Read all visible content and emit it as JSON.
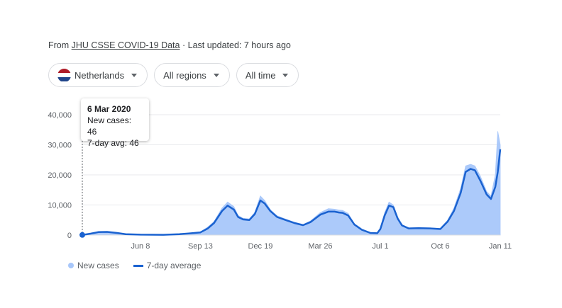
{
  "source": {
    "prefix": "From",
    "link": "JHU CSSE COVID-19 Data",
    "separator": "·",
    "updated": "Last updated: 7 hours ago"
  },
  "filters": {
    "country": "Netherlands",
    "region": "All regions",
    "time": "All time"
  },
  "flag_colors": [
    "#ae1c28",
    "#ffffff",
    "#21468b"
  ],
  "colors": {
    "bars": "#a8c7fa",
    "line": "#1a62d0",
    "grid": "#e8eaed",
    "axis_text": "#5f6368"
  },
  "tooltip": {
    "date": "6 Mar 2020",
    "new_cases": "New cases: 46",
    "avg": "7-day avg: 46"
  },
  "legend": {
    "new_cases": "New cases",
    "avg": "7-day average"
  },
  "chart_data": {
    "type": "area",
    "ylim": [
      0,
      40000
    ],
    "y_ticks": [
      {
        "value": 0,
        "label": "0"
      },
      {
        "value": 10000,
        "label": "10,000"
      },
      {
        "value": 20000,
        "label": "20,000"
      },
      {
        "value": 30000,
        "label": "30,000"
      },
      {
        "value": 40000,
        "label": "40,000"
      }
    ],
    "x_range": [
      "2020-03-06",
      "2022-01-11"
    ],
    "x_ticks": [
      {
        "date": "2020-06-08",
        "label": "Jun 8"
      },
      {
        "date": "2020-09-13",
        "label": "Sep 13"
      },
      {
        "date": "2020-12-19",
        "label": "Dec 19"
      },
      {
        "date": "2021-03-26",
        "label": "Mar 26"
      },
      {
        "date": "2021-07-01",
        "label": "Jul 1"
      },
      {
        "date": "2021-10-06",
        "label": "Oct 6"
      },
      {
        "date": "2022-01-11",
        "label": "Jan 11"
      }
    ],
    "series": [
      {
        "name": "7-day average",
        "points": [
          [
            "2020-03-06",
            46
          ],
          [
            "2020-03-20",
            500
          ],
          [
            "2020-04-01",
            1000
          ],
          [
            "2020-04-15",
            1050
          ],
          [
            "2020-05-01",
            700
          ],
          [
            "2020-05-15",
            300
          ],
          [
            "2020-06-08",
            150
          ],
          [
            "2020-07-15",
            100
          ],
          [
            "2020-08-10",
            300
          ],
          [
            "2020-08-25",
            550
          ],
          [
            "2020-09-13",
            900
          ],
          [
            "2020-09-25",
            2200
          ],
          [
            "2020-10-05",
            4000
          ],
          [
            "2020-10-18",
            8000
          ],
          [
            "2020-10-27",
            9800
          ],
          [
            "2020-11-06",
            8500
          ],
          [
            "2020-11-13",
            6000
          ],
          [
            "2020-11-21",
            5200
          ],
          [
            "2020-12-01",
            5000
          ],
          [
            "2020-12-10",
            7000
          ],
          [
            "2020-12-19",
            11500
          ],
          [
            "2020-12-26",
            10500
          ],
          [
            "2021-01-04",
            8000
          ],
          [
            "2021-01-15",
            6000
          ],
          [
            "2021-01-29",
            5000
          ],
          [
            "2021-02-12",
            4000
          ],
          [
            "2021-02-26",
            3300
          ],
          [
            "2021-03-10",
            4300
          ],
          [
            "2021-03-26",
            6800
          ],
          [
            "2021-04-08",
            7800
          ],
          [
            "2021-04-18",
            7800
          ],
          [
            "2021-04-25",
            7500
          ],
          [
            "2021-05-01",
            7400
          ],
          [
            "2021-05-10",
            6500
          ],
          [
            "2021-05-20",
            3500
          ],
          [
            "2021-06-01",
            1800
          ],
          [
            "2021-06-15",
            700
          ],
          [
            "2021-06-26",
            600
          ],
          [
            "2021-07-01",
            2000
          ],
          [
            "2021-07-08",
            6500
          ],
          [
            "2021-07-15",
            9800
          ],
          [
            "2021-07-22",
            9300
          ],
          [
            "2021-07-29",
            5500
          ],
          [
            "2021-08-05",
            3200
          ],
          [
            "2021-08-16",
            2200
          ],
          [
            "2021-09-01",
            2300
          ],
          [
            "2021-09-20",
            2200
          ],
          [
            "2021-10-06",
            2000
          ],
          [
            "2021-10-18",
            4500
          ],
          [
            "2021-10-28",
            8000
          ],
          [
            "2021-11-08",
            14000
          ],
          [
            "2021-11-16",
            21000
          ],
          [
            "2021-11-24",
            22000
          ],
          [
            "2021-12-01",
            21500
          ],
          [
            "2021-12-10",
            18000
          ],
          [
            "2021-12-20",
            13500
          ],
          [
            "2021-12-27",
            12000
          ],
          [
            "2022-01-03",
            16000
          ],
          [
            "2022-01-07",
            21000
          ],
          [
            "2022-01-11",
            28500
          ]
        ]
      },
      {
        "name": "New cases",
        "points": [
          [
            "2020-03-06",
            46
          ],
          [
            "2020-03-20",
            550
          ],
          [
            "2020-04-01",
            1200
          ],
          [
            "2020-04-15",
            1200
          ],
          [
            "2020-05-01",
            800
          ],
          [
            "2020-05-15",
            300
          ],
          [
            "2020-06-08",
            150
          ],
          [
            "2020-07-15",
            120
          ],
          [
            "2020-08-10",
            350
          ],
          [
            "2020-08-25",
            600
          ],
          [
            "2020-09-13",
            1000
          ],
          [
            "2020-09-25",
            2700
          ],
          [
            "2020-10-05",
            4500
          ],
          [
            "2020-10-18",
            9000
          ],
          [
            "2020-10-27",
            11000
          ],
          [
            "2020-11-06",
            9500
          ],
          [
            "2020-11-13",
            6500
          ],
          [
            "2020-11-21",
            5600
          ],
          [
            "2020-12-01",
            5400
          ],
          [
            "2020-12-10",
            7600
          ],
          [
            "2020-12-19",
            13000
          ],
          [
            "2020-12-26",
            11500
          ],
          [
            "2021-01-04",
            8500
          ],
          [
            "2021-01-15",
            6400
          ],
          [
            "2021-01-29",
            5300
          ],
          [
            "2021-02-12",
            4300
          ],
          [
            "2021-02-26",
            3500
          ],
          [
            "2021-03-10",
            4700
          ],
          [
            "2021-03-26",
            7500
          ],
          [
            "2021-04-08",
            8800
          ],
          [
            "2021-04-18",
            8600
          ],
          [
            "2021-04-25",
            8300
          ],
          [
            "2021-05-01",
            8200
          ],
          [
            "2021-05-10",
            7200
          ],
          [
            "2021-05-20",
            3800
          ],
          [
            "2021-06-01",
            2000
          ],
          [
            "2021-06-15",
            800
          ],
          [
            "2021-06-26",
            700
          ],
          [
            "2021-07-01",
            2500
          ],
          [
            "2021-07-08",
            7500
          ],
          [
            "2021-07-15",
            11000
          ],
          [
            "2021-07-22",
            10000
          ],
          [
            "2021-07-29",
            6000
          ],
          [
            "2021-08-05",
            3500
          ],
          [
            "2021-08-16",
            2400
          ],
          [
            "2021-09-01",
            2500
          ],
          [
            "2021-09-20",
            2400
          ],
          [
            "2021-10-06",
            2200
          ],
          [
            "2021-10-18",
            5000
          ],
          [
            "2021-10-28",
            9000
          ],
          [
            "2021-11-08",
            15500
          ],
          [
            "2021-11-16",
            23000
          ],
          [
            "2021-11-24",
            23500
          ],
          [
            "2021-12-01",
            23000
          ],
          [
            "2021-12-10",
            19500
          ],
          [
            "2021-12-20",
            14500
          ],
          [
            "2021-12-27",
            13000
          ],
          [
            "2022-01-03",
            20000
          ],
          [
            "2022-01-07",
            34500
          ],
          [
            "2022-01-11",
            30000
          ]
        ]
      }
    ],
    "legend_position": "bottom-left",
    "grid": true
  }
}
